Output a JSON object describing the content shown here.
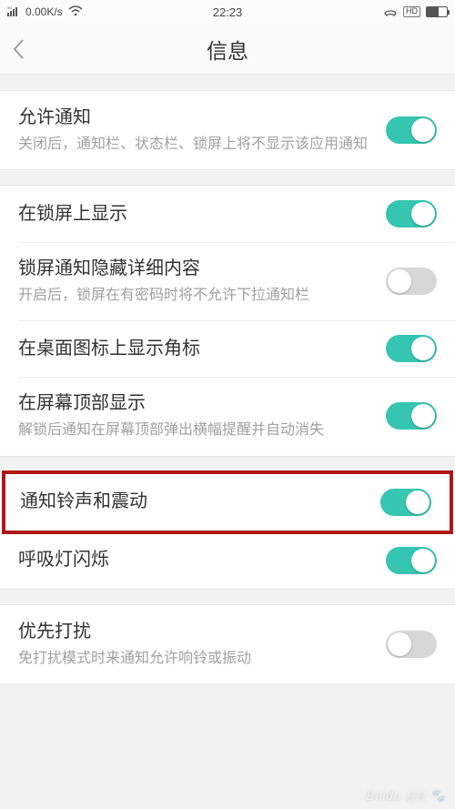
{
  "status": {
    "signal_label": "4G",
    "speed": "0.00K/s",
    "time": "22:23",
    "call_icon": "phone-hd",
    "hd_label": "HD"
  },
  "header": {
    "title": "信息"
  },
  "groups": [
    {
      "rows": [
        {
          "title": "允许通知",
          "sub": "关闭后，通知栏、状态栏、锁屏上将不显示该应用通知",
          "on": true
        }
      ]
    },
    {
      "rows": [
        {
          "title": "在锁屏上显示",
          "sub": "",
          "on": true
        },
        {
          "title": "锁屏通知隐藏详细内容",
          "sub": "开启后，锁屏在有密码时将不允许下拉通知栏",
          "on": false
        },
        {
          "title": "在桌面图标上显示角标",
          "sub": "",
          "on": true
        },
        {
          "title": "在屏幕顶部显示",
          "sub": "解锁后通知在屏幕顶部弹出横幅提醒并自动消失",
          "on": true
        }
      ]
    },
    {
      "rows": [
        {
          "title": "通知铃声和震动",
          "sub": "",
          "on": true,
          "highlight": true
        },
        {
          "title": "呼吸灯闪烁",
          "sub": "",
          "on": true
        }
      ]
    },
    {
      "rows": [
        {
          "title": "优先打扰",
          "sub": "免打扰模式时来通知允许响铃或振动",
          "on": false
        }
      ]
    }
  ],
  "watermark": {
    "brand": "Baidu",
    "sub": "经验"
  }
}
